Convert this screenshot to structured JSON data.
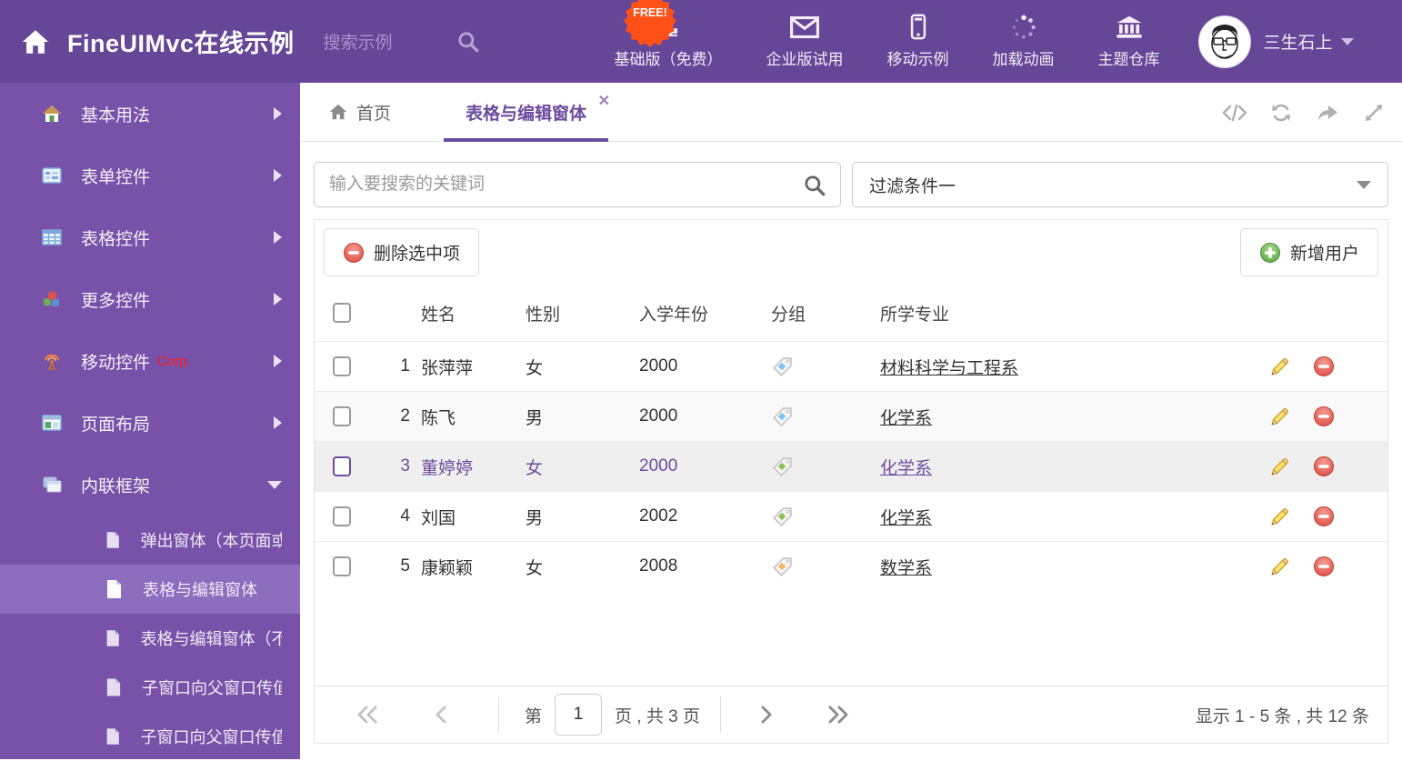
{
  "colors": {
    "accent": "#6b4c9e",
    "header_bg": "#664696",
    "sidebar_bg": "#7852a8",
    "sidebar_active_bg": "#8d6dbd",
    "badge_orange": "#ff5117",
    "delete_red": "#e4574d",
    "add_green": "#6cb645"
  },
  "header": {
    "logo": "FineUIMvc在线示例",
    "search_placeholder": "搜索示例",
    "free_badge": "FREE!",
    "nav": [
      {
        "icon": "download-icon",
        "label": "基础版（免费）"
      },
      {
        "icon": "envelope-icon",
        "label": "企业版试用"
      },
      {
        "icon": "mobile-icon",
        "label": "移动示例"
      },
      {
        "icon": "spinner-icon",
        "label": "加载动画"
      },
      {
        "icon": "bank-icon",
        "label": "主题仓库"
      }
    ],
    "user_name": "三生石上"
  },
  "sidebar": {
    "items": [
      {
        "label": "基本用法"
      },
      {
        "label": "表单控件"
      },
      {
        "label": "表格控件"
      },
      {
        "label": "更多控件"
      },
      {
        "label": "移动控件",
        "badge": "Corp."
      },
      {
        "label": "页面布局"
      },
      {
        "label": "内联框架"
      }
    ],
    "subitems": [
      {
        "label": "弹出窗体（本页面或..."
      },
      {
        "label": "表格与编辑窗体"
      },
      {
        "label": "表格与编辑窗体（不..."
      },
      {
        "label": "子窗口向父窗口传值"
      },
      {
        "label": "子窗口向父窗口传值..."
      }
    ]
  },
  "tabs": {
    "home": "首页",
    "active": "表格与编辑窗体",
    "close": "✕"
  },
  "filters": {
    "search_placeholder": "输入要搜索的关键词",
    "filter_value": "过滤条件一"
  },
  "grid_toolbar": {
    "delete_label": "删除选中项",
    "add_label": "新增用户"
  },
  "table": {
    "columns": {
      "name": "姓名",
      "gender": "性别",
      "year": "入学年份",
      "group": "分组",
      "major": "所学专业"
    },
    "rows": [
      {
        "num": "1",
        "name": "张萍萍",
        "gender": "女",
        "year": "2000",
        "tag_color": "#7ec3f0",
        "major": "材料科学与工程系"
      },
      {
        "num": "2",
        "name": "陈飞",
        "gender": "男",
        "year": "2000",
        "tag_color": "#7ec3f0",
        "major": "化学系"
      },
      {
        "num": "3",
        "name": "董婷婷",
        "gender": "女",
        "year": "2000",
        "tag_color": "#8dc153",
        "major": "化学系"
      },
      {
        "num": "4",
        "name": "刘国",
        "gender": "男",
        "year": "2002",
        "tag_color": "#8dc153",
        "major": "化学系"
      },
      {
        "num": "5",
        "name": "康颖颖",
        "gender": "女",
        "year": "2008",
        "tag_color": "#f9b26b",
        "major": "数学系"
      }
    ]
  },
  "pagination": {
    "prefix": "第",
    "page": "1",
    "total": "页 , 共 3 页",
    "summary": "显示 1 - 5 条 , 共 12 条"
  }
}
